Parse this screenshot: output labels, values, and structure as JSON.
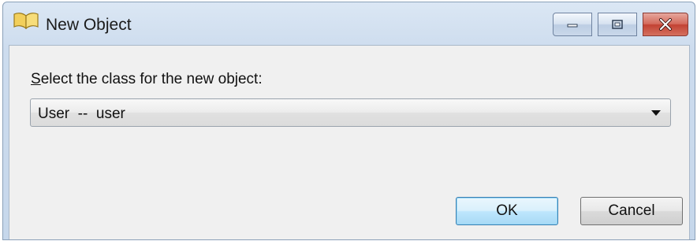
{
  "window": {
    "title": "New Object",
    "icon": "open-book-icon",
    "caption_buttons": {
      "minimize": "minimize-icon",
      "maximize": "maximize-icon",
      "close": "close-icon"
    }
  },
  "form": {
    "prompt_mnemonic": "S",
    "prompt_rest": "elect the class for the new object:",
    "class_select": {
      "selected_value": "User  --  user"
    }
  },
  "buttons": {
    "ok_label": "OK",
    "cancel_label": "Cancel"
  },
  "colors": {
    "title_bar": "#cddcee",
    "client_area": "#f0f0f0",
    "close_button": "#c24233",
    "default_button_border": "#3c7fb1"
  }
}
